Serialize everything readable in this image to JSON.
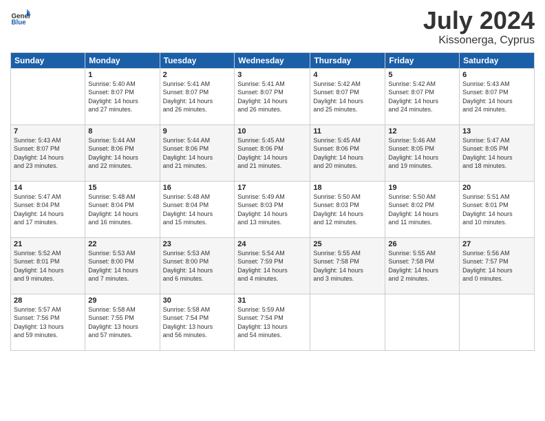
{
  "logo": {
    "general": "General",
    "blue": "Blue"
  },
  "title": "July 2024",
  "location": "Kissonerga, Cyprus",
  "weekdays": [
    "Sunday",
    "Monday",
    "Tuesday",
    "Wednesday",
    "Thursday",
    "Friday",
    "Saturday"
  ],
  "weeks": [
    [
      {
        "day": "",
        "info": ""
      },
      {
        "day": "1",
        "info": "Sunrise: 5:40 AM\nSunset: 8:07 PM\nDaylight: 14 hours\nand 27 minutes."
      },
      {
        "day": "2",
        "info": "Sunrise: 5:41 AM\nSunset: 8:07 PM\nDaylight: 14 hours\nand 26 minutes."
      },
      {
        "day": "3",
        "info": "Sunrise: 5:41 AM\nSunset: 8:07 PM\nDaylight: 14 hours\nand 26 minutes."
      },
      {
        "day": "4",
        "info": "Sunrise: 5:42 AM\nSunset: 8:07 PM\nDaylight: 14 hours\nand 25 minutes."
      },
      {
        "day": "5",
        "info": "Sunrise: 5:42 AM\nSunset: 8:07 PM\nDaylight: 14 hours\nand 24 minutes."
      },
      {
        "day": "6",
        "info": "Sunrise: 5:43 AM\nSunset: 8:07 PM\nDaylight: 14 hours\nand 24 minutes."
      }
    ],
    [
      {
        "day": "7",
        "info": "Sunrise: 5:43 AM\nSunset: 8:07 PM\nDaylight: 14 hours\nand 23 minutes."
      },
      {
        "day": "8",
        "info": "Sunrise: 5:44 AM\nSunset: 8:06 PM\nDaylight: 14 hours\nand 22 minutes."
      },
      {
        "day": "9",
        "info": "Sunrise: 5:44 AM\nSunset: 8:06 PM\nDaylight: 14 hours\nand 21 minutes."
      },
      {
        "day": "10",
        "info": "Sunrise: 5:45 AM\nSunset: 8:06 PM\nDaylight: 14 hours\nand 21 minutes."
      },
      {
        "day": "11",
        "info": "Sunrise: 5:45 AM\nSunset: 8:06 PM\nDaylight: 14 hours\nand 20 minutes."
      },
      {
        "day": "12",
        "info": "Sunrise: 5:46 AM\nSunset: 8:05 PM\nDaylight: 14 hours\nand 19 minutes."
      },
      {
        "day": "13",
        "info": "Sunrise: 5:47 AM\nSunset: 8:05 PM\nDaylight: 14 hours\nand 18 minutes."
      }
    ],
    [
      {
        "day": "14",
        "info": "Sunrise: 5:47 AM\nSunset: 8:04 PM\nDaylight: 14 hours\nand 17 minutes."
      },
      {
        "day": "15",
        "info": "Sunrise: 5:48 AM\nSunset: 8:04 PM\nDaylight: 14 hours\nand 16 minutes."
      },
      {
        "day": "16",
        "info": "Sunrise: 5:48 AM\nSunset: 8:04 PM\nDaylight: 14 hours\nand 15 minutes."
      },
      {
        "day": "17",
        "info": "Sunrise: 5:49 AM\nSunset: 8:03 PM\nDaylight: 14 hours\nand 13 minutes."
      },
      {
        "day": "18",
        "info": "Sunrise: 5:50 AM\nSunset: 8:03 PM\nDaylight: 14 hours\nand 12 minutes."
      },
      {
        "day": "19",
        "info": "Sunrise: 5:50 AM\nSunset: 8:02 PM\nDaylight: 14 hours\nand 11 minutes."
      },
      {
        "day": "20",
        "info": "Sunrise: 5:51 AM\nSunset: 8:01 PM\nDaylight: 14 hours\nand 10 minutes."
      }
    ],
    [
      {
        "day": "21",
        "info": "Sunrise: 5:52 AM\nSunset: 8:01 PM\nDaylight: 14 hours\nand 9 minutes."
      },
      {
        "day": "22",
        "info": "Sunrise: 5:53 AM\nSunset: 8:00 PM\nDaylight: 14 hours\nand 7 minutes."
      },
      {
        "day": "23",
        "info": "Sunrise: 5:53 AM\nSunset: 8:00 PM\nDaylight: 14 hours\nand 6 minutes."
      },
      {
        "day": "24",
        "info": "Sunrise: 5:54 AM\nSunset: 7:59 PM\nDaylight: 14 hours\nand 4 minutes."
      },
      {
        "day": "25",
        "info": "Sunrise: 5:55 AM\nSunset: 7:58 PM\nDaylight: 14 hours\nand 3 minutes."
      },
      {
        "day": "26",
        "info": "Sunrise: 5:55 AM\nSunset: 7:58 PM\nDaylight: 14 hours\nand 2 minutes."
      },
      {
        "day": "27",
        "info": "Sunrise: 5:56 AM\nSunset: 7:57 PM\nDaylight: 14 hours\nand 0 minutes."
      }
    ],
    [
      {
        "day": "28",
        "info": "Sunrise: 5:57 AM\nSunset: 7:56 PM\nDaylight: 13 hours\nand 59 minutes."
      },
      {
        "day": "29",
        "info": "Sunrise: 5:58 AM\nSunset: 7:55 PM\nDaylight: 13 hours\nand 57 minutes."
      },
      {
        "day": "30",
        "info": "Sunrise: 5:58 AM\nSunset: 7:54 PM\nDaylight: 13 hours\nand 56 minutes."
      },
      {
        "day": "31",
        "info": "Sunrise: 5:59 AM\nSunset: 7:54 PM\nDaylight: 13 hours\nand 54 minutes."
      },
      {
        "day": "",
        "info": ""
      },
      {
        "day": "",
        "info": ""
      },
      {
        "day": "",
        "info": ""
      }
    ]
  ]
}
